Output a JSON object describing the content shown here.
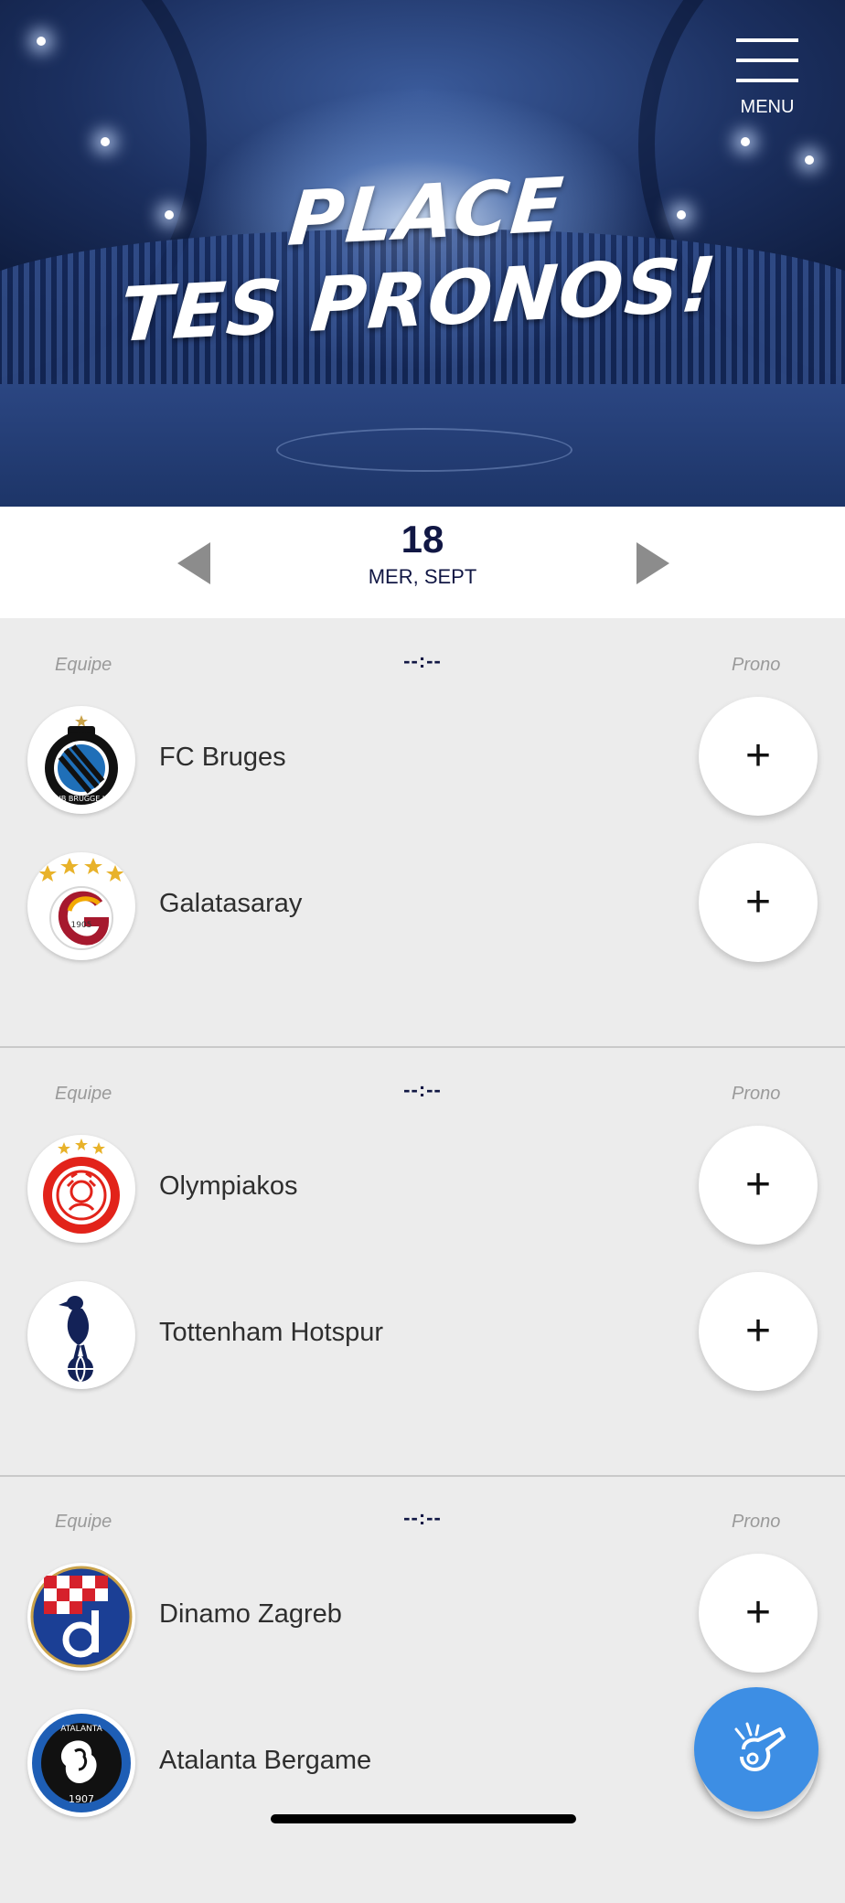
{
  "hero": {
    "title_line1": "PLACE",
    "title_line2": "TES PRONOS!",
    "menu_label": "MENU"
  },
  "date": {
    "day": "18",
    "weekday_month": "MER, SEPT"
  },
  "labels": {
    "team_header": "Equipe",
    "prono_header": "Prono",
    "plus": "+"
  },
  "matches": [
    {
      "score": "--:--",
      "home": {
        "name": "FC Bruges",
        "logo_icon": "club-brugge-crest-icon"
      },
      "away": {
        "name": "Galatasaray",
        "logo_icon": "galatasaray-crest-icon"
      }
    },
    {
      "score": "--:--",
      "home": {
        "name": "Olympiakos",
        "logo_icon": "olympiakos-crest-icon"
      },
      "away": {
        "name": "Tottenham Hotspur",
        "logo_icon": "tottenham-crest-icon"
      }
    },
    {
      "score": "--:--",
      "home": {
        "name": "Dinamo Zagreb",
        "logo_icon": "dinamo-zagreb-crest-icon"
      },
      "away": {
        "name": "Atalanta Bergame",
        "logo_icon": "atalanta-crest-icon"
      }
    }
  ],
  "logo_text": {
    "bruges": "CLUB BRUGGE K.V.",
    "galatasaray": "1905",
    "atalanta_top": "ATALANTA",
    "atalanta_year": "1907"
  },
  "colors": {
    "navy": "#111744",
    "fab": "#3d8ee4",
    "background": "#ececec"
  },
  "fab_icon": "whistle-icon"
}
